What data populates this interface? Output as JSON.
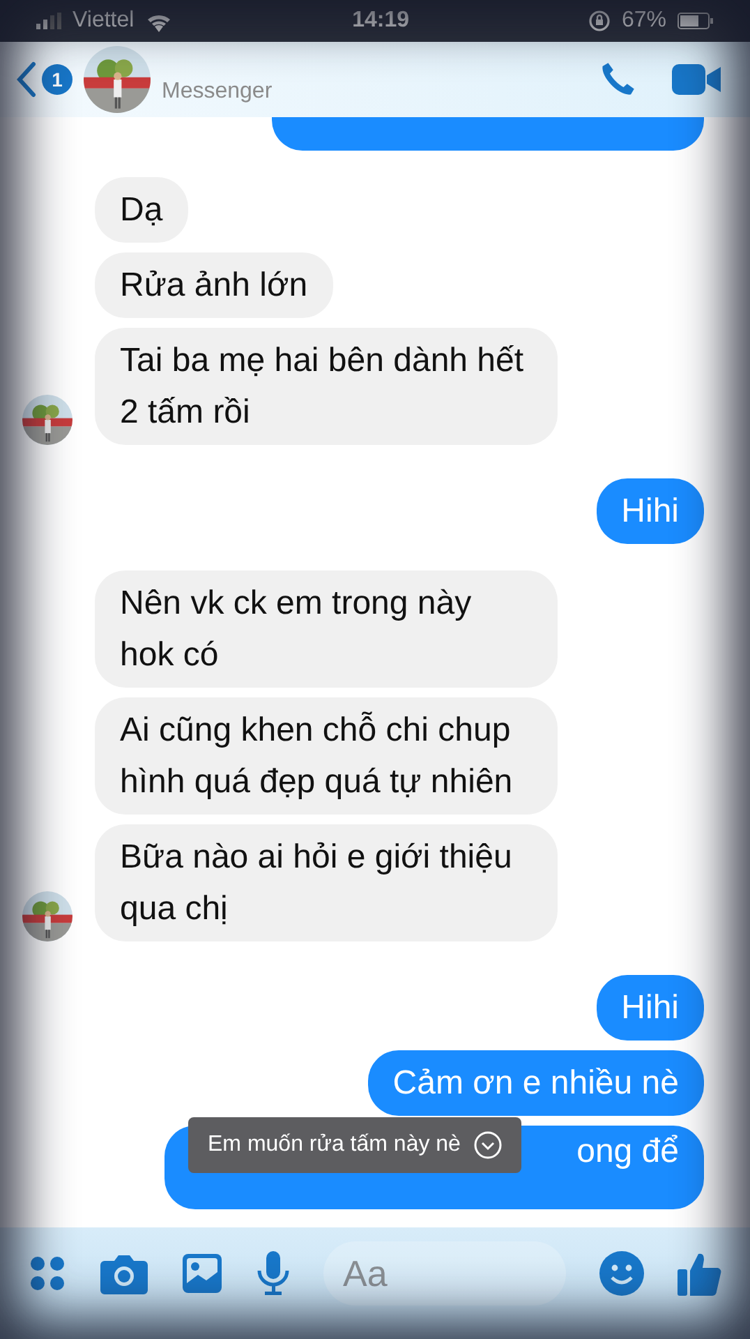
{
  "status_bar": {
    "carrier": "Viettel",
    "time": "14:19",
    "battery": "67%"
  },
  "header": {
    "unread_count": "1",
    "subtitle": "Messenger"
  },
  "messages": [
    {
      "kind": "outgoing_cut"
    },
    {
      "kind": "incoming",
      "text": "Dạ",
      "show_avatar": false
    },
    {
      "kind": "incoming",
      "text": "Rửa ảnh lớn",
      "show_avatar": false
    },
    {
      "kind": "incoming",
      "text": "Tai ba mẹ hai bên dành hết 2 tấm rồi",
      "show_avatar": true
    },
    {
      "kind": "outgoing",
      "text": "Hihi"
    },
    {
      "kind": "incoming",
      "text": "Nên vk ck em trong này hok có",
      "show_avatar": false
    },
    {
      "kind": "incoming",
      "text": "Ai cũng khen chỗ chi chup hình quá đẹp quá tự nhiên",
      "show_avatar": false
    },
    {
      "kind": "incoming",
      "text": "Bữa nào ai hỏi e giới thiệu qua chị",
      "show_avatar": true
    },
    {
      "kind": "outgoing",
      "text": "Hihi"
    },
    {
      "kind": "outgoing",
      "text": "Cảm ơn e nhiều nè"
    },
    {
      "kind": "outgoing_partial",
      "text": "ong để"
    }
  ],
  "reply_preview": {
    "text": "Em muốn rửa tấm này nè"
  },
  "composer": {
    "placeholder": "Aa"
  }
}
